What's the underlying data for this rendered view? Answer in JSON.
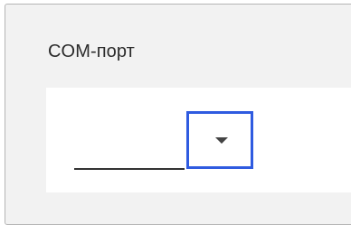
{
  "panel": {
    "title": "COM-порт"
  },
  "com_port_select": {
    "selected_value": "",
    "icon": "caret-down-icon",
    "focus_color": "#2f5be0"
  }
}
